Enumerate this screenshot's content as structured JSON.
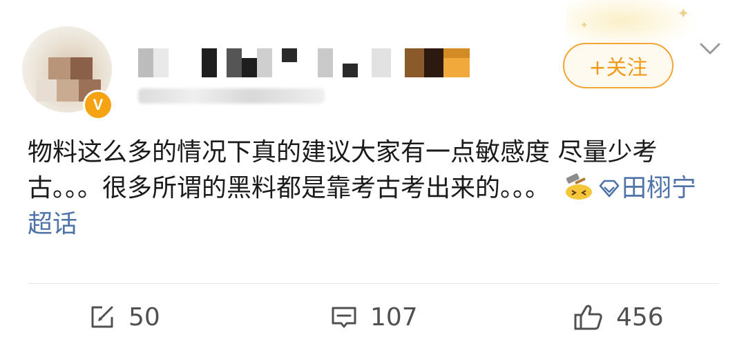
{
  "post": {
    "follow_label": "+关注",
    "content_text": "物料这么多的情况下真的建议大家有一点敏感度 尽量少考古。。。很多所谓的黑料都是靠考古考出来的。。。",
    "topic_label": "田栩宁超话",
    "emoji_icon": "hammer-face-emoji",
    "verified_badge": "V"
  },
  "actions": {
    "repost_count": "50",
    "comment_count": "107",
    "like_count": "456"
  },
  "colors": {
    "accent_orange": "#f09a1a",
    "topic_blue": "#4f73a8",
    "badge_orange": "#f6a313"
  }
}
